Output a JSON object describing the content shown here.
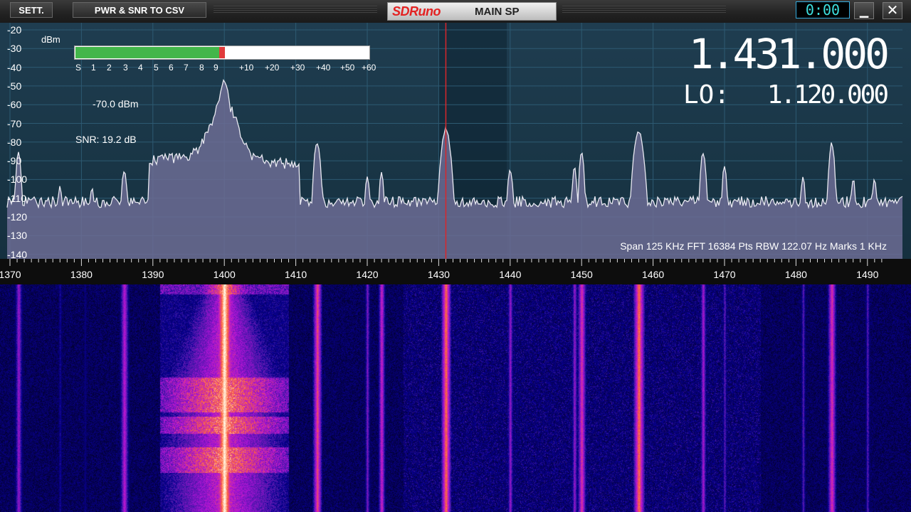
{
  "titlebar": {
    "settings_label": "SETT.",
    "csv_label": "PWR & SNR TO CSV",
    "logo": "SDRuno",
    "panel_name": "MAIN SP",
    "clock": "0:00",
    "minimize_glyph": "▁",
    "close_glyph": "✕"
  },
  "spectrum": {
    "db_unit": "dBm",
    "db_labels": [
      "-20",
      "-30",
      "-40",
      "-50",
      "-60",
      "-70",
      "-80",
      "-90",
      "-100",
      "-110",
      "-120",
      "-130",
      "-140"
    ],
    "smeter": {
      "scale": [
        "S",
        "1",
        "2",
        "3",
        "4",
        "5",
        "6",
        "7",
        "8",
        "9",
        "+10",
        "+20",
        "+30",
        "+40",
        "+50",
        "+60"
      ],
      "level_fraction": 0.49,
      "colors": {
        "fill": "#43b64a",
        "peak": "#e03b3b"
      }
    },
    "power_readout": "-70.0 dBm",
    "snr_readout": "SNR: 19.2 dB",
    "frequency": "1.431.000",
    "lo_label": "LO:",
    "lo_frequency": "1.120.000",
    "info": "Span 125 KHz   FFT 16384 Pts   RBW 122.07 Hz   Marks 1 KHz",
    "tuned_khz": 1431,
    "colors": {
      "trace_fill": "#6c6c94",
      "trace_line": "#e8e8f0",
      "tuner_line": "#d9262a",
      "grid": "#2d5a72"
    }
  },
  "ruler": {
    "labels": [
      "1370",
      "1380",
      "1390",
      "1400",
      "1410",
      "1420",
      "1430",
      "1440",
      "1450",
      "1460",
      "1470",
      "1480",
      "1490"
    ]
  },
  "waterfall": {
    "colors": {
      "low": "#000010",
      "mid": "#6a22c8",
      "high": "#ffd060"
    }
  }
}
